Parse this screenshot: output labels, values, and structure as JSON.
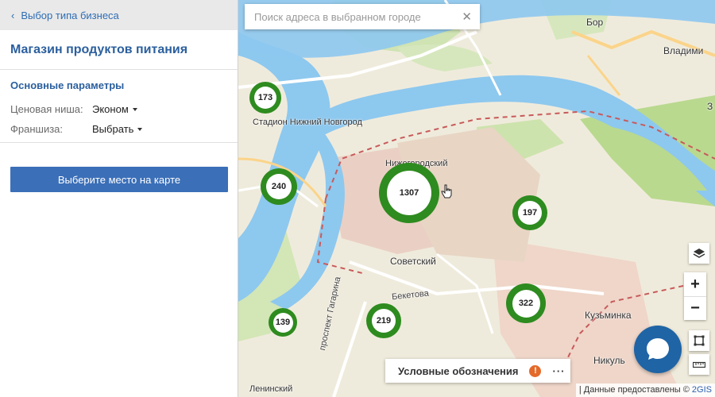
{
  "sidebar": {
    "back_label": "Выбор типа бизнеса",
    "business_title": "Магазин продуктов питания",
    "params_title": "Основные параметры",
    "price_label": "Ценовая ниша:",
    "price_value": "Эконом",
    "franchise_label": "Франшиза:",
    "franchise_value": "Выбрать",
    "choose_button": "Выберите место на карте"
  },
  "map": {
    "search_placeholder": "Поиск адреса в выбранном городе",
    "labels": {
      "bor": "Бор",
      "vladimir": "Владими",
      "stadium": "Стадион Нижний Новгород",
      "nizhegorodsky": "Нижегородский",
      "sovetsky": "Советский",
      "beketova": "Бекетова",
      "kuzminka": "Кузьминка",
      "nikulino": "Никуль",
      "leninsky": "Ленинский",
      "gagarina": "проспект Гагарина",
      "z": "З"
    },
    "clusters": [
      {
        "id": "173",
        "count": "173"
      },
      {
        "id": "240",
        "count": "240"
      },
      {
        "id": "1307",
        "count": "1307"
      },
      {
        "id": "197",
        "count": "197"
      },
      {
        "id": "322",
        "count": "322"
      },
      {
        "id": "219",
        "count": "219"
      },
      {
        "id": "139",
        "count": "139"
      }
    ],
    "zoom_in": "+",
    "zoom_out": "−",
    "legend_label": "Условные обозначения",
    "legend_warning": "!",
    "legend_more": "···",
    "attribution_text": "| Данные предоставлены © ",
    "attribution_link": "2GIS"
  },
  "colors": {
    "accent_blue": "#3b6fb8",
    "cluster_green": "#2e8b1f",
    "water": "#8dc8ef",
    "chat_blue": "#1f64a5"
  },
  "icons": {
    "back": "chevron-left-icon",
    "clear": "close-icon",
    "layers": "layers-icon",
    "fullscreen": "fullscreen-icon",
    "ruler": "ruler-icon",
    "chat": "chat-bubble-icon",
    "warning": "warning-icon"
  }
}
